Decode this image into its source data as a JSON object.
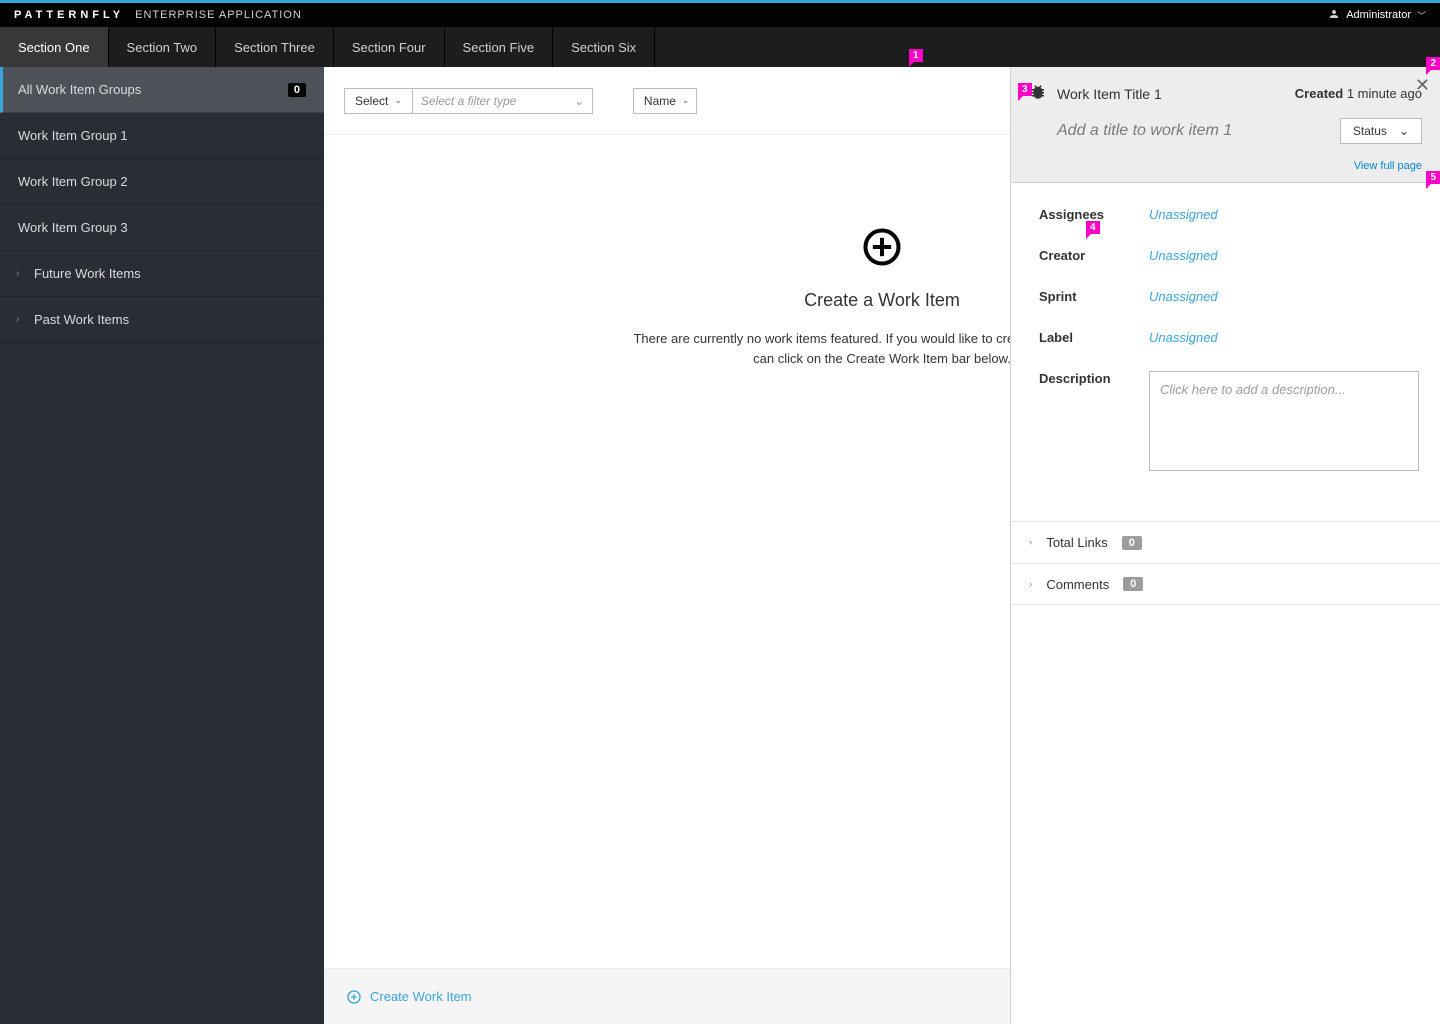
{
  "brand": {
    "name": "PATTERNFLY",
    "sub": "ENTERPRISE APPLICATION"
  },
  "user": {
    "name": "Administrator"
  },
  "nav": {
    "items": [
      {
        "label": "Section One"
      },
      {
        "label": "Section Two"
      },
      {
        "label": "Section Three"
      },
      {
        "label": "Section Four"
      },
      {
        "label": "Section Five"
      },
      {
        "label": "Section Six"
      }
    ]
  },
  "sidebar": {
    "all": {
      "label": "All Work Item Groups",
      "count": "0"
    },
    "groups": [
      {
        "label": "Work Item Group 1"
      },
      {
        "label": "Work Item Group 2"
      },
      {
        "label": "Work Item Group 3"
      }
    ],
    "sections": [
      {
        "label": "Future Work Items"
      },
      {
        "label": "Past Work Items"
      }
    ]
  },
  "toolbar": {
    "select_label": "Select",
    "filter_placeholder": "Select a filter type",
    "sort_label": "Name"
  },
  "empty": {
    "title": "Create a Work Item",
    "desc": "There are currently no work items featured. If you would like to create a work item, you can click on the Create Work Item bar below."
  },
  "footer": {
    "create_label": "Create Work Item"
  },
  "panel": {
    "title": "Work Item Title 1",
    "created_label": "Created",
    "created_time": "1 minute ago",
    "subtitle": "Add a title to work item 1",
    "status_label": "Status",
    "view_full": "View full page",
    "fields": {
      "assignees": {
        "label": "Assignees",
        "value": "Unassigned"
      },
      "creator": {
        "label": "Creator",
        "value": "Unassigned"
      },
      "sprint": {
        "label": "Sprint",
        "value": "Unassigned"
      },
      "label": {
        "label": "Label",
        "value": "Unassigned"
      },
      "description": {
        "label": "Description",
        "placeholder": "Click here to add a description..."
      }
    },
    "links": {
      "label": "Total Links",
      "count": "0"
    },
    "comments": {
      "label": "Comments",
      "count": "0"
    }
  },
  "markers": {
    "m1": "1",
    "m2": "2",
    "m3": "3",
    "m4": "4",
    "m5": "5"
  }
}
